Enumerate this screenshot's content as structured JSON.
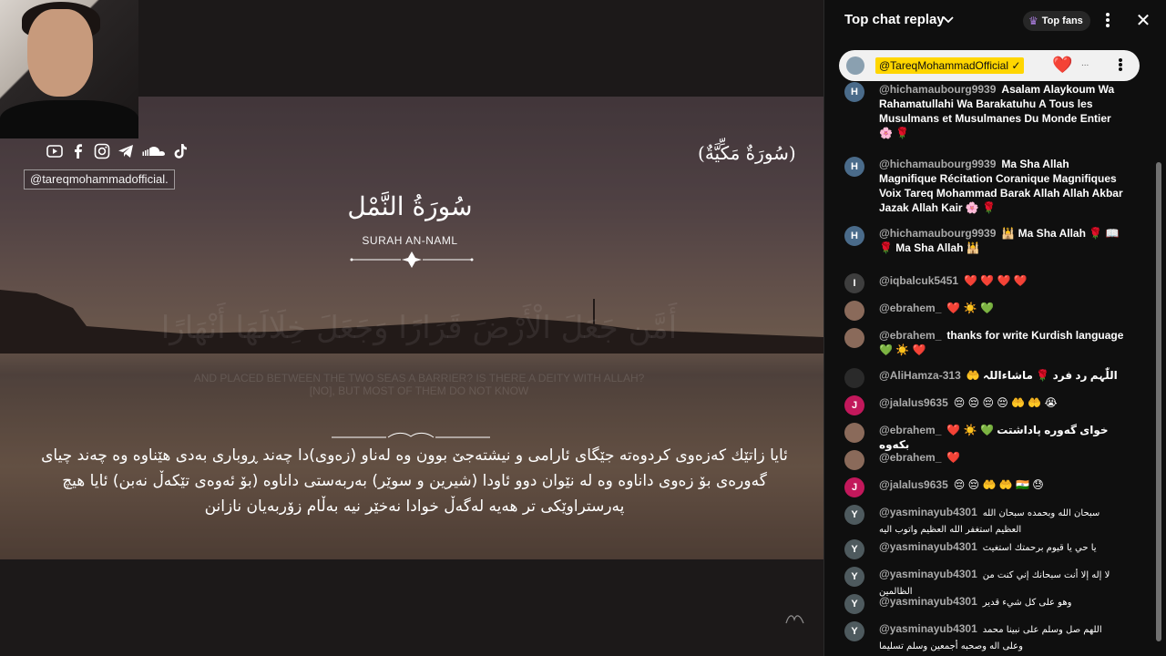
{
  "video": {
    "social_icons": [
      "youtube-icon",
      "facebook-icon",
      "instagram-icon",
      "telegram-icon",
      "soundcloud-icon",
      "tiktok-icon"
    ],
    "handle": "@tareqmohammadofficial.",
    "surah_type": "(سُورَةٌ مَكِّيَّةٌ)",
    "surah_name_ar": "سُورَةُ النَّمْل",
    "surah_name_en": "SURAH AN-NAML",
    "faded_ar": "أَمَّن جَعَلَ الْأَرْضَ قَرَارًا وَجَعَلَ خِلَالَهَا أَنْهَارًا",
    "faded_en_line1": "AND PLACED BETWEEN THE TWO SEAS A BARRIER? IS THERE A DEITY WITH ALLAH?",
    "faded_en_line2": "[NO], BUT MOST OF THEM DO NOT KNOW",
    "subtitle": "ئایا زاتێك کەزەوی کردوەتە جێگای ئارامی و نیشتەجێ بوون وە لەناو (زەوی)دا چەند ڕوباری بەدی هێناوە وە چەند چیای گەورەی بۆ زەوی داناوە وە لە نێوان دوو ئاودا (شیرین و سوێر) بەربەستی داناوە (بۆ ئەوەی تێکەڵ نەبن) ئایا هیچ پەرستراوێکی تر هەیە لەگەڵ خوادا نەخێر نیە بەڵام زۆربەیان نازانن"
  },
  "chat": {
    "title": "Top chat replay",
    "top_fans_label": "Top fans",
    "pinned": {
      "author": "@TareqMohammadOfficial ✓",
      "emoji": "❤️",
      "more": "..."
    },
    "messages": [
      {
        "avatar": "H",
        "author": "@hichamaubourg9939",
        "text": "Asalam Alaykoum Wa Rahamatullahi Wa Barakatuhu A Tous les Musulmans et Musulmanes Du Monde Entier 🌸 🌹"
      },
      {
        "avatar": "H",
        "author": "@hichamaubourg9939",
        "text": "Ma Sha Allah Magnifique Récitation Coranique Magnifiques Voix Tareq Mohammad Barak Allah Allah Akbar Jazak Allah Kair 🌸 🌹"
      },
      {
        "avatar": "H",
        "author": "@hichamaubourg9939",
        "text": "🕌 Ma Sha Allah 🌹 📖 🌹 Ma Sha Allah 🕌"
      },
      {
        "avatar": "I",
        "author": "@iqbalcuk5451",
        "text": "❤️ ❤️ ❤️ ❤️"
      },
      {
        "avatar": "",
        "author": "@ebrahem_",
        "text": "❤️ ☀️ 💚"
      },
      {
        "avatar": "",
        "author": "@ebrahem_",
        "text": "thanks for write Kurdish language 💚 ☀️ ❤️"
      },
      {
        "avatar": "",
        "author": "@AliHamza-313",
        "text": "🤲 اللّٰہم رد فرد 🌹 ماشاءاللہ"
      },
      {
        "avatar": "J",
        "author": "@jalalus9635",
        "text": "😔 😔 😔 😔 🤲 🤲 😭"
      },
      {
        "avatar": "",
        "author": "@ebrahem_",
        "text": "❤️ ☀️ 💚 خوای گەورە پاداشتت بکەوە"
      },
      {
        "avatar": "",
        "author": "@ebrahem_",
        "text": "❤️"
      },
      {
        "avatar": "J",
        "author": "@jalalus9635",
        "text": "😔 😔 🤲 🤲 🇮🇳 😓"
      },
      {
        "avatar": "Y",
        "author": "@yasminayub4301",
        "text": "سبحان الله وبحمده سبحان الله العظيم استغفر الله العظيم واتوب اليه"
      },
      {
        "avatar": "Y",
        "author": "@yasminayub4301",
        "text": "يا حي يا قيوم برحمتك استغيث"
      },
      {
        "avatar": "Y",
        "author": "@yasminayub4301",
        "text": "لا إله إلا أنت سبحانك إني كنت من الظالمين"
      },
      {
        "avatar": "Y",
        "author": "@yasminayub4301",
        "text": "وهو على كل شيء قدير"
      },
      {
        "avatar": "Y",
        "author": "@yasminayub4301",
        "text": "اللهم صل وسلم على نبينا محمد وعلى اله وصحبه أجمعين وسلم تسليما"
      }
    ]
  },
  "colors": {
    "chat_bg": "#0f0f0f",
    "author_text": "#aaaaaa",
    "pinned_bg": "#f1f1f1",
    "owner_badge": "#ffd600",
    "avatar_h": "#2f5fa0",
    "avatar_i": "#3a3a3a",
    "avatar_j": "#c2185b",
    "avatar_y": "#4a4a4a"
  }
}
